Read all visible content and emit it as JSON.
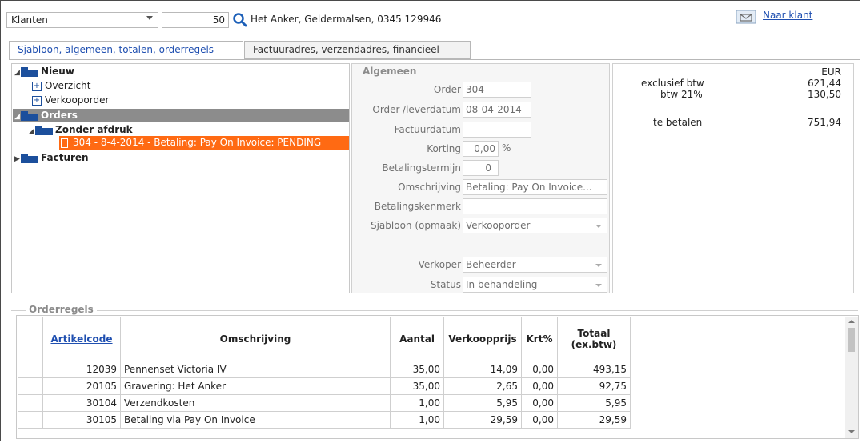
{
  "top": {
    "relation_type": "Klanten",
    "client_number": "50",
    "client_info": "Het Anker, Geldermalsen, 0345 129946",
    "naar_klant": "Naar klant"
  },
  "tabs": [
    {
      "label": "Sjabloon, algemeen, totalen, orderregels"
    },
    {
      "label": "Factuuradres, verzendadres, financieel"
    }
  ],
  "tree": {
    "nieuw": "Nieuw",
    "overzicht": "Overzicht",
    "verkooporder": "Verkooporder",
    "orders": "Orders",
    "zonder_afdruk": "Zonder afdruk",
    "order_item": "304 - 8-4-2014 - Betaling: Pay On Invoice: PENDING",
    "facturen": "Facturen"
  },
  "algemeen": {
    "legend": "Algemeen",
    "order_label": "Order",
    "order_value": "304",
    "leverdatum_label": "Order-/leverdatum",
    "leverdatum_value": "08-04-2014",
    "factuurdatum_label": "Factuurdatum",
    "factuurdatum_value": "",
    "korting_label": "Korting",
    "korting_value": "0,00",
    "korting_unit": "%",
    "termijn_label": "Betalingstermijn",
    "termijn_value": "0",
    "omschrijving_label": "Omschrijving",
    "omschrijving_value": "Betaling: Pay On Invoice...",
    "kenmerk_label": "Betalingskenmerk",
    "kenmerk_value": "",
    "sjabloon_label": "Sjabloon (opmaak)",
    "sjabloon_value": "Verkooporder",
    "verkoper_label": "Verkoper",
    "verkoper_value": "Beheerder",
    "status_label": "Status",
    "status_value": "In behandeling"
  },
  "totals": {
    "currency": "EUR",
    "excl_label": "exclusief btw",
    "excl_value": "621,44",
    "btw_label": "btw 21%",
    "btw_value": "130,50",
    "divider": "----------------",
    "te_betalen_label": "te betalen",
    "te_betalen_value": "751,94"
  },
  "orderregels": {
    "legend": "Orderregels",
    "columns": [
      "Artikelcode",
      "Omschrijving",
      "Aantal",
      "Verkoopprijs",
      "Krt%",
      "Totaal (ex.btw)"
    ],
    "rows": [
      {
        "code": "12039",
        "omschrijving": "Pennenset Victoria IV",
        "aantal": "35,00",
        "prijs": "14,09",
        "krt": "0,00",
        "totaal": "493,15"
      },
      {
        "code": "20105",
        "omschrijving": "Gravering: Het Anker",
        "aantal": "35,00",
        "prijs": "2,65",
        "krt": "0,00",
        "totaal": "92,75"
      },
      {
        "code": "30104",
        "omschrijving": "Verzendkosten",
        "aantal": "1,00",
        "prijs": "5,95",
        "krt": "0,00",
        "totaal": "5,95"
      },
      {
        "code": "30105",
        "omschrijving": "Betaling via Pay On Invoice",
        "aantal": "1,00",
        "prijs": "29,59",
        "krt": "0,00",
        "totaal": "29,59"
      }
    ]
  },
  "colors": {
    "accent_orange": "#ff6a13",
    "selection_gray": "#8c8c8c",
    "link_blue": "#1f4fb0",
    "folder_blue": "#1c4f9c"
  }
}
